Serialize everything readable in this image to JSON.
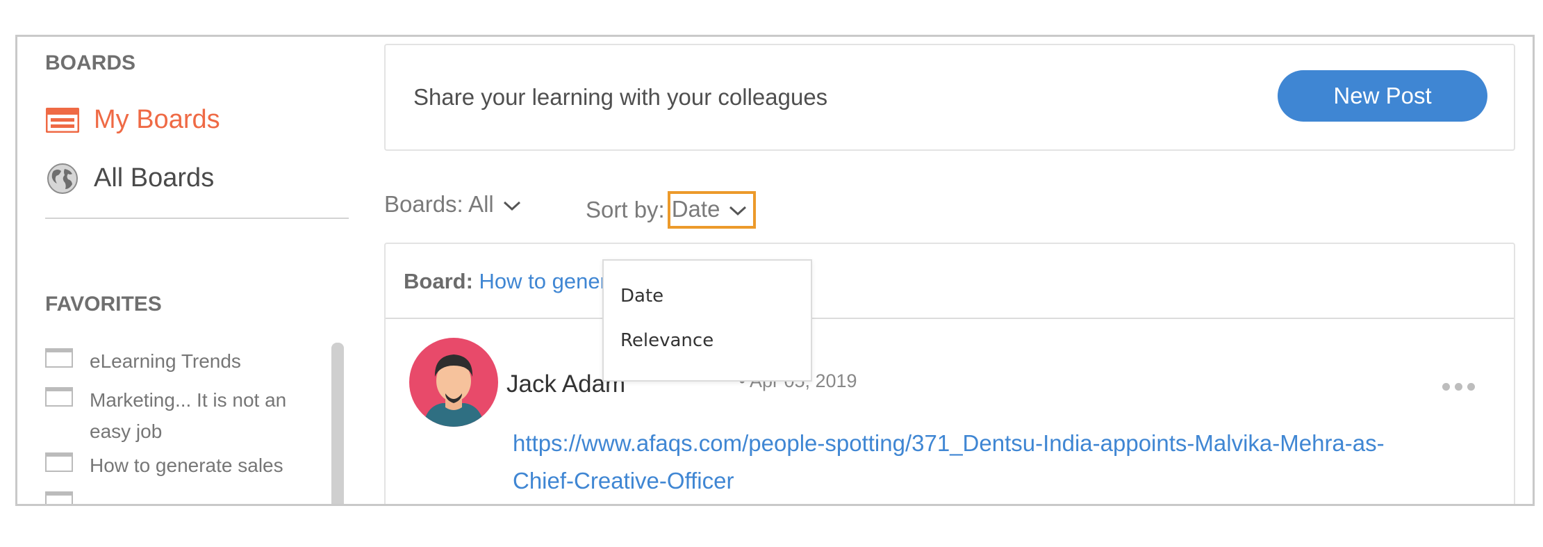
{
  "sidebar": {
    "boards_heading": "BOARDS",
    "nav": [
      {
        "label": "My Boards",
        "icon": "boards-icon",
        "active": true
      },
      {
        "label": "All Boards",
        "icon": "globe-icon",
        "active": false
      }
    ],
    "favorites_heading": "FAVORITES",
    "favorites": [
      {
        "label": "eLearning Trends",
        "icon": "board-icon"
      },
      {
        "label": "Marketing... It is not an easy job",
        "icon": "board-icon"
      },
      {
        "label": "How to generate sales",
        "icon": "board-icon"
      }
    ]
  },
  "share": {
    "prompt": "Share your learning with your colleagues",
    "new_post_label": "New Post"
  },
  "filters": {
    "boards_label": "Boards: All",
    "sort_label": "Sort by:",
    "sort_value": "Date",
    "sort_options": [
      "Date",
      "Relevance"
    ]
  },
  "post": {
    "board_key": "Board:",
    "board_name": "How to generate sales",
    "author": "Jack Adam",
    "meta": "˙ • Apr 05, 2019",
    "link": "https://www.afaqs.com/people-spotting/371_Dentsu-India-appoints-Malvika-Mehra-as-Chief-Creative-Officer"
  },
  "colors": {
    "accent": "#ef6a45",
    "primary_button": "#3f86d3",
    "highlight_box": "#ec9a2b",
    "link": "#3f86d3"
  }
}
